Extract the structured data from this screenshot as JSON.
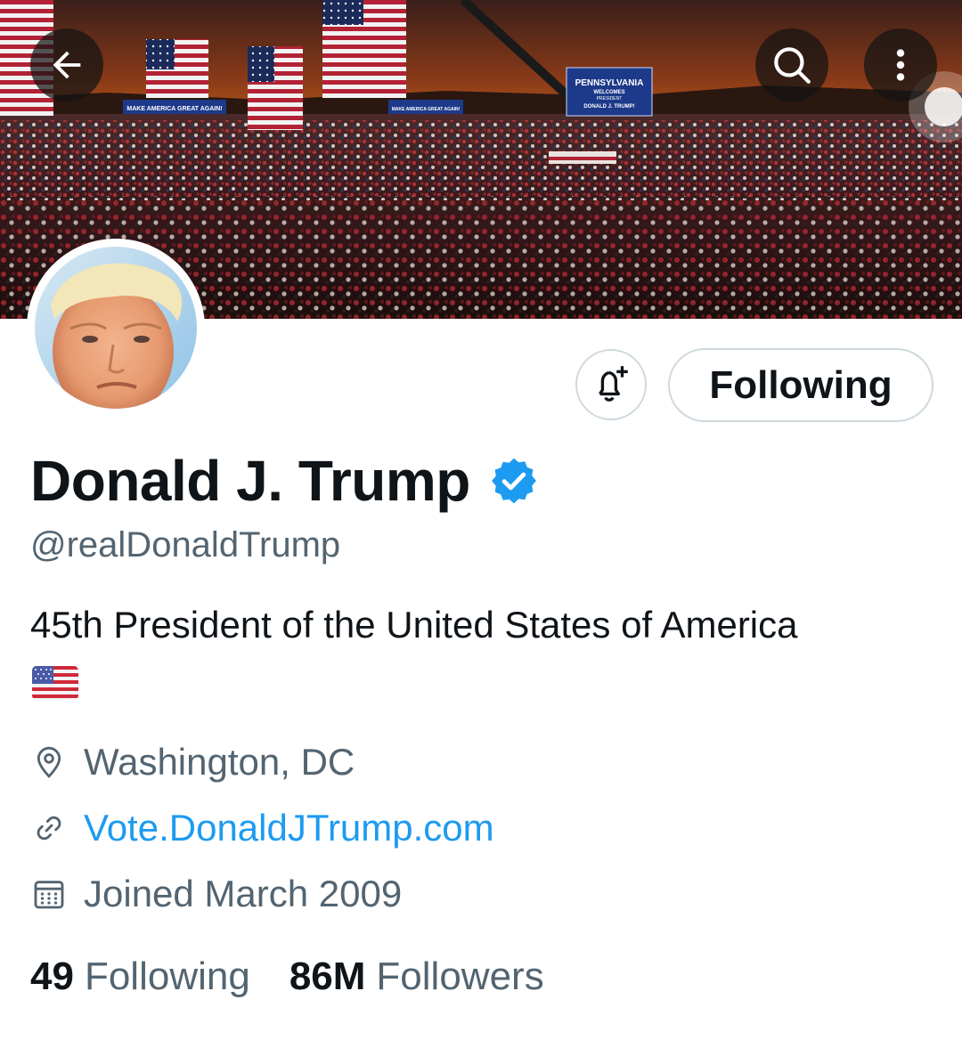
{
  "banner": {
    "signs": {
      "rally_sign_left": "MAKE AMERICA GREAT AGAIN!",
      "rally_sign_center": "MAKE AMERICA GREAT AGAIN!",
      "state_sign_line1": "PENNSYLVANIA",
      "state_sign_line2": "WELCOMES",
      "state_sign_line3": "PRESIDENT",
      "state_sign_line4": "DONALD J. TRUMP!"
    },
    "icons": {
      "back": "arrow-left-icon",
      "search": "search-icon",
      "more": "more-vertical-icon"
    }
  },
  "profile": {
    "display_name": "Donald J. Trump",
    "verified_icon": "verified-badge-icon",
    "handle": "@realDonaldTrump",
    "bio": "45th President of the United States of America",
    "bio_emoji": "us-flag-emoji",
    "location": "Washington, DC",
    "website": "Vote.DonaldJTrump.com",
    "joined": "Joined March 2009"
  },
  "actions": {
    "notify_icon": "bell-plus-icon",
    "following_label": "Following"
  },
  "stats": {
    "following_count": "49",
    "following_label": "Following",
    "followers_count": "86M",
    "followers_label": "Followers"
  },
  "colors": {
    "text_primary": "#0f1419",
    "text_secondary": "#536471",
    "accent": "#1d9bf0",
    "border": "#cfd9de"
  }
}
